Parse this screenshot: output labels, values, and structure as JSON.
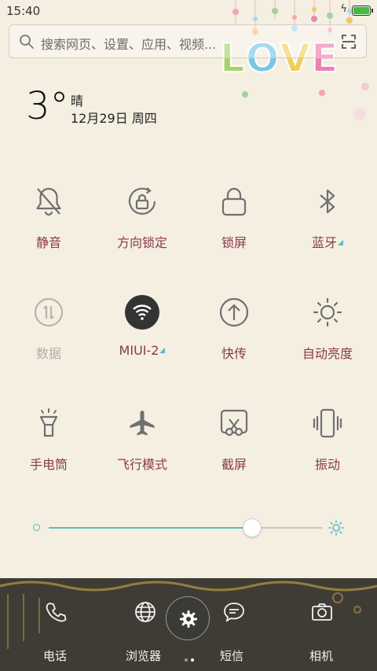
{
  "status": {
    "time": "15:40",
    "battery_level": 1.0
  },
  "search": {
    "placeholder": "搜索网页、设置、应用、视频..."
  },
  "decoration": {
    "love_text": "LOVE"
  },
  "weather": {
    "temperature": "3°",
    "condition": "晴",
    "date": "12月29日 周四"
  },
  "toggles": [
    {
      "label": "静音",
      "icon": "bell-off-icon",
      "active": false
    },
    {
      "label": "方向锁定",
      "icon": "rotation-lock-icon",
      "active": false
    },
    {
      "label": "锁屏",
      "icon": "lock-icon",
      "active": false
    },
    {
      "label": "蓝牙",
      "icon": "bluetooth-icon",
      "active": false,
      "has_more": true
    },
    {
      "label": "数据",
      "icon": "mobile-data-icon",
      "active": false,
      "disabled": true
    },
    {
      "label": "MIUI-2",
      "icon": "wifi-icon",
      "active": true,
      "has_more": true
    },
    {
      "label": "快传",
      "icon": "upload-icon",
      "active": false
    },
    {
      "label": "自动亮度",
      "icon": "sun-icon",
      "active": false
    },
    {
      "label": "手电筒",
      "icon": "flashlight-icon",
      "active": false
    },
    {
      "label": "飞行模式",
      "icon": "airplane-icon",
      "active": false
    },
    {
      "label": "截屏",
      "icon": "screenshot-icon",
      "active": false
    },
    {
      "label": "振动",
      "icon": "vibrate-icon",
      "active": false
    }
  ],
  "brightness": {
    "level": 0.74
  },
  "dock": {
    "phone_label": "电话",
    "browser_label": "浏览器",
    "sms_label": "短信",
    "camera_label": "相机",
    "pager_current": 2,
    "pager_total": 2
  },
  "colors": {
    "accent": "#5bbac2",
    "label": "#8a3a4a",
    "panel_bg": "#f4efe1"
  }
}
